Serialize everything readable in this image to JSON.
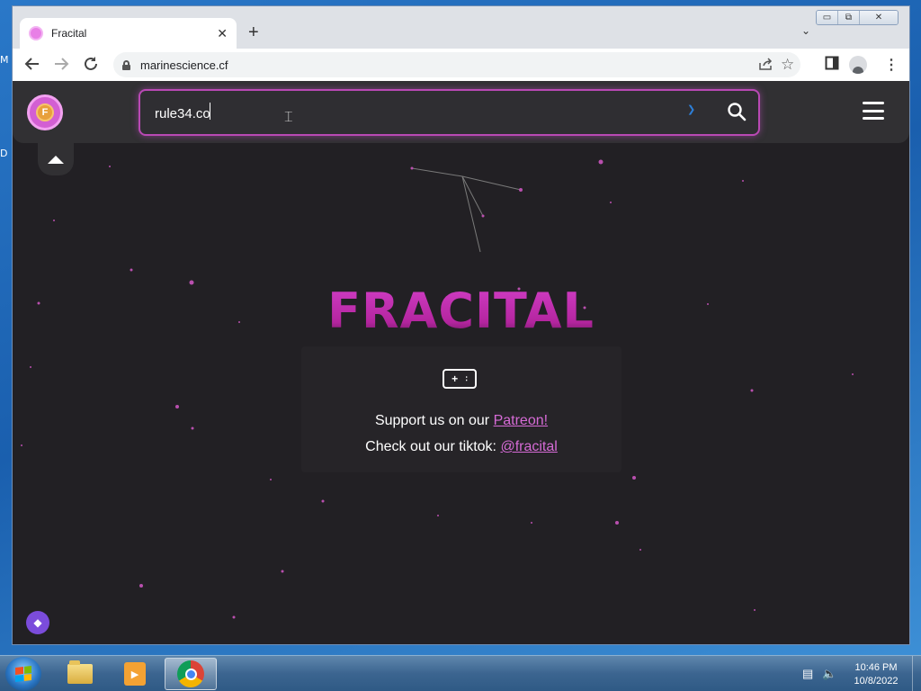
{
  "desktop": {
    "fragment_1": "M",
    "fragment_2": "D"
  },
  "browser": {
    "tab_title": "Fracital",
    "tab_close_glyph": "✕",
    "new_tab_glyph": "+",
    "address": "marinescience.cf",
    "window_controls": {
      "minimize": "▭",
      "restore": "⧉",
      "close": "✕"
    }
  },
  "site": {
    "search_value": "rule34.co",
    "title": "FRACITAL",
    "support_prefix": "Support us on our ",
    "support_link": "Patreon!",
    "tiktok_prefix": "Check out our tiktok: ",
    "tiktok_link": "@fracital",
    "accent_color": "#c234b6",
    "link_color": "#d66bd6"
  },
  "taskbar": {
    "time": "10:46 PM",
    "date": "10/8/2022"
  },
  "icons": {
    "back": "arrow-left-icon",
    "forward": "arrow-right-icon",
    "reload": "reload-icon",
    "share": "share-icon",
    "bookmark": "star-icon",
    "side_panel": "side-panel-icon",
    "menu": "kebab-menu-icon",
    "search": "search-icon",
    "hamburger": "hamburger-menu-icon",
    "collapse": "chevron-up-icon",
    "gamepad": "gamepad-icon",
    "fab": "diamond-icon"
  }
}
